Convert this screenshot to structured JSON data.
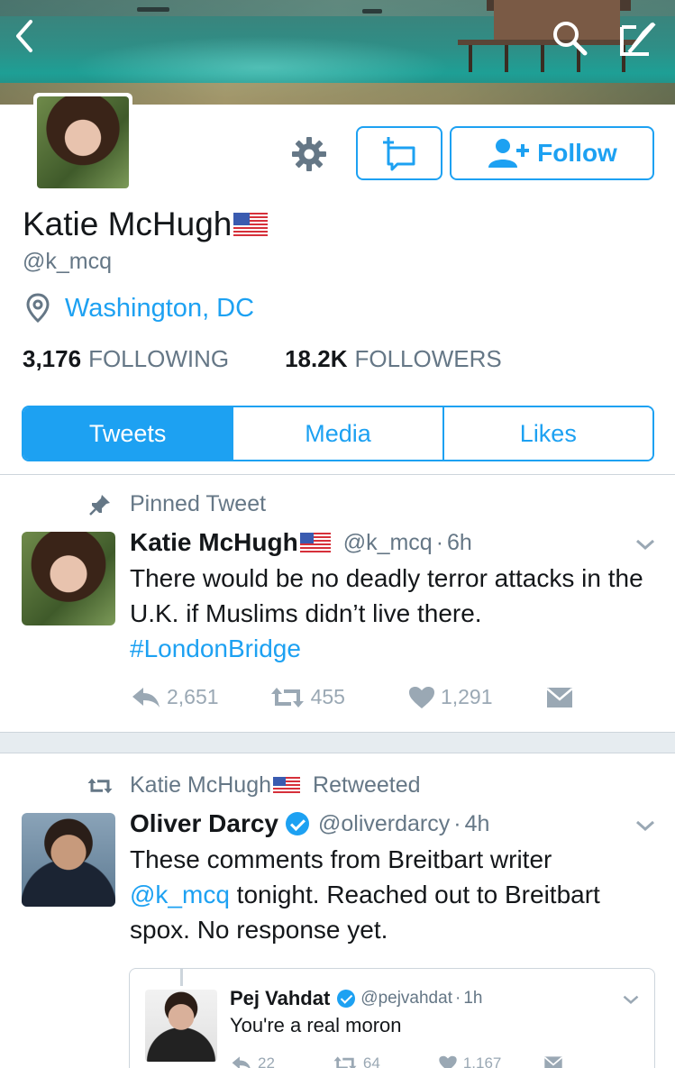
{
  "profile": {
    "name": "Katie McHugh",
    "handle": "@k_mcq",
    "location": "Washington, DC",
    "following_count": "3,176",
    "following_label": "FOLLOWING",
    "followers_count": "18.2K",
    "followers_label": "FOLLOWERS",
    "follow_label": "Follow"
  },
  "tabs": [
    {
      "label": "Tweets",
      "active": true
    },
    {
      "label": "Media",
      "active": false
    },
    {
      "label": "Likes",
      "active": false
    }
  ],
  "pinned": {
    "context_label": "Pinned Tweet",
    "name": "Katie McHugh",
    "handle": "@k_mcq",
    "time": "6h",
    "text_1": "There would be no deadly terror attacks in the U.K. if Muslims didn’t live there.",
    "hashtag": "#LondonBridge",
    "replies": "2,651",
    "retweets": "455",
    "likes": "1,291"
  },
  "retweet": {
    "context_name": "Katie McHugh",
    "context_label": "Retweeted",
    "name": "Oliver Darcy",
    "handle": "@oliverdarcy",
    "time": "4h",
    "text_1": "These comments from Breitbart writer",
    "mention": "@k_mcq",
    "text_2": " tonight. Reached out to Breitbart spox. No response yet."
  },
  "quoted": {
    "name": "Pej Vahdat",
    "handle": "@pejvahdat",
    "time": "1h",
    "text": "You're a real moron",
    "replies": "22",
    "retweets": "64",
    "likes": "1,167"
  },
  "colors": {
    "accent": "#1da1f2",
    "muted": "#657786"
  }
}
